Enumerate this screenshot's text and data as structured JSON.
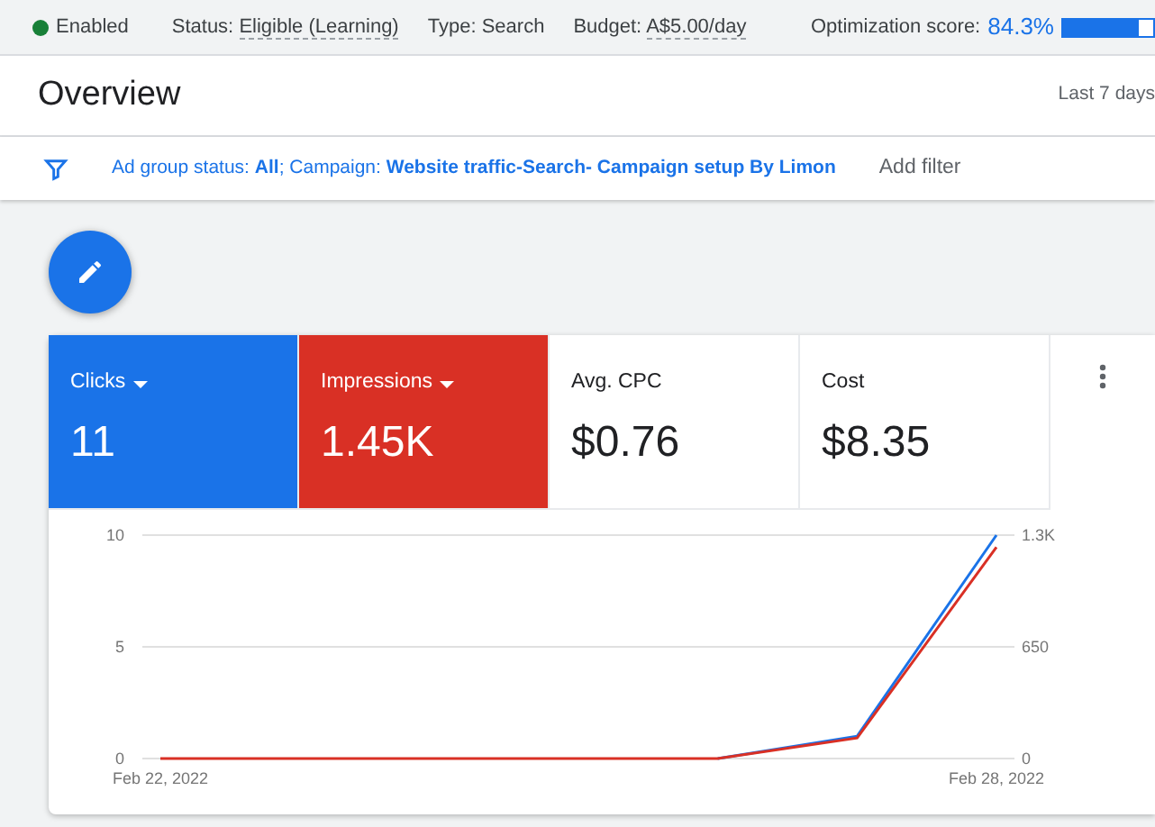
{
  "status_bar": {
    "state": "Enabled",
    "status_label": "Status:",
    "status": "Eligible (Learning)",
    "type_label": "Type:",
    "type": "Search",
    "budget_label": "Budget:",
    "budget": "A$5.00/day",
    "optimization_label": "Optimization score:",
    "optimization_score": "84.3%",
    "optimization_bar": {
      "level": 0.843
    }
  },
  "header": {
    "title": "Overview",
    "date_range": "Last 7 days"
  },
  "filter_bar": {
    "filter_text": "Ad group status: **All**; Campaign: **Website traffic-Search- Campaign setup By Limon**",
    "add_filter": "Add filter"
  },
  "metrics": [
    {
      "label": "Clicks",
      "value": "11",
      "selected": true,
      "color": "#1a73e8",
      "dropdown": true
    },
    {
      "label": "Impressions",
      "value": "1.45K",
      "selected": true,
      "color": "#d93025",
      "dropdown": true
    },
    {
      "label": "Avg. CPC",
      "value": "$0.76",
      "selected": false,
      "dropdown": false
    },
    {
      "label": "Cost",
      "value": "$8.35",
      "selected": false,
      "dropdown": false
    }
  ],
  "chart": {
    "chart_data": {
      "type": "line",
      "categories": [
        "Feb 22, 2022",
        null,
        null,
        null,
        null,
        null,
        "Feb 28, 2022"
      ],
      "yticks": [
        0,
        5,
        10
      ],
      "ylim": [
        0,
        10
      ],
      "y2ticks": [
        {
          "value": 0,
          "label": "0"
        },
        {
          "value": 650,
          "label": "650"
        },
        {
          "value": 1300,
          "label": "1.3K"
        }
      ],
      "y2lim": [
        0,
        1300
      ],
      "series": [
        {
          "color": "#1a73e8",
          "axis": "y",
          "values": [
            null,
            null,
            null,
            null,
            0,
            1,
            10
          ]
        },
        {
          "color": "#d93025",
          "axis": "y2",
          "values": [
            0,
            0,
            0,
            0,
            0,
            120,
            1230
          ]
        }
      ]
    }
  }
}
